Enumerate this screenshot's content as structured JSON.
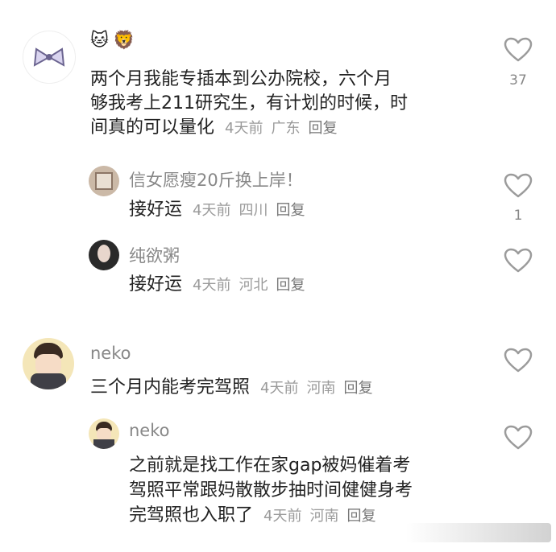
{
  "comments": [
    {
      "author_emojis": [
        "🐱",
        "🦁"
      ],
      "text_lines": [
        "两个月我能专插本到公办院校，六个月",
        "够我考上211研究生，有计划的时候，时",
        "间真的可以量化"
      ],
      "time": "4天前",
      "location": "广东",
      "reply_label": "回复",
      "likes": "37"
    },
    {
      "author": "信女愿瘦20斤换上岸！",
      "text": "接好运",
      "time": "4天前",
      "location": "四川",
      "reply_label": "回复",
      "likes": "1"
    },
    {
      "author": "纯欲粥",
      "text": "接好运",
      "time": "4天前",
      "location": "河北",
      "reply_label": "回复"
    },
    {
      "author": "neko",
      "text": "三个月内能考完驾照",
      "time": "4天前",
      "location": "河南",
      "reply_label": "回复"
    },
    {
      "author": "neko",
      "text_lines": [
        "之前就是找工作在家gap被妈催着考",
        "驾照平常跟妈散散步抽时间健健身考",
        "完驾照也入职了"
      ],
      "time": "4天前",
      "location": "河南",
      "reply_label": "回复"
    }
  ],
  "colors": {
    "icon_gray": "#9b9b9b",
    "meta_gray": "#9a9a9a"
  },
  "icons": [
    "heart-outline-icon",
    "bow-avatar-icon"
  ]
}
